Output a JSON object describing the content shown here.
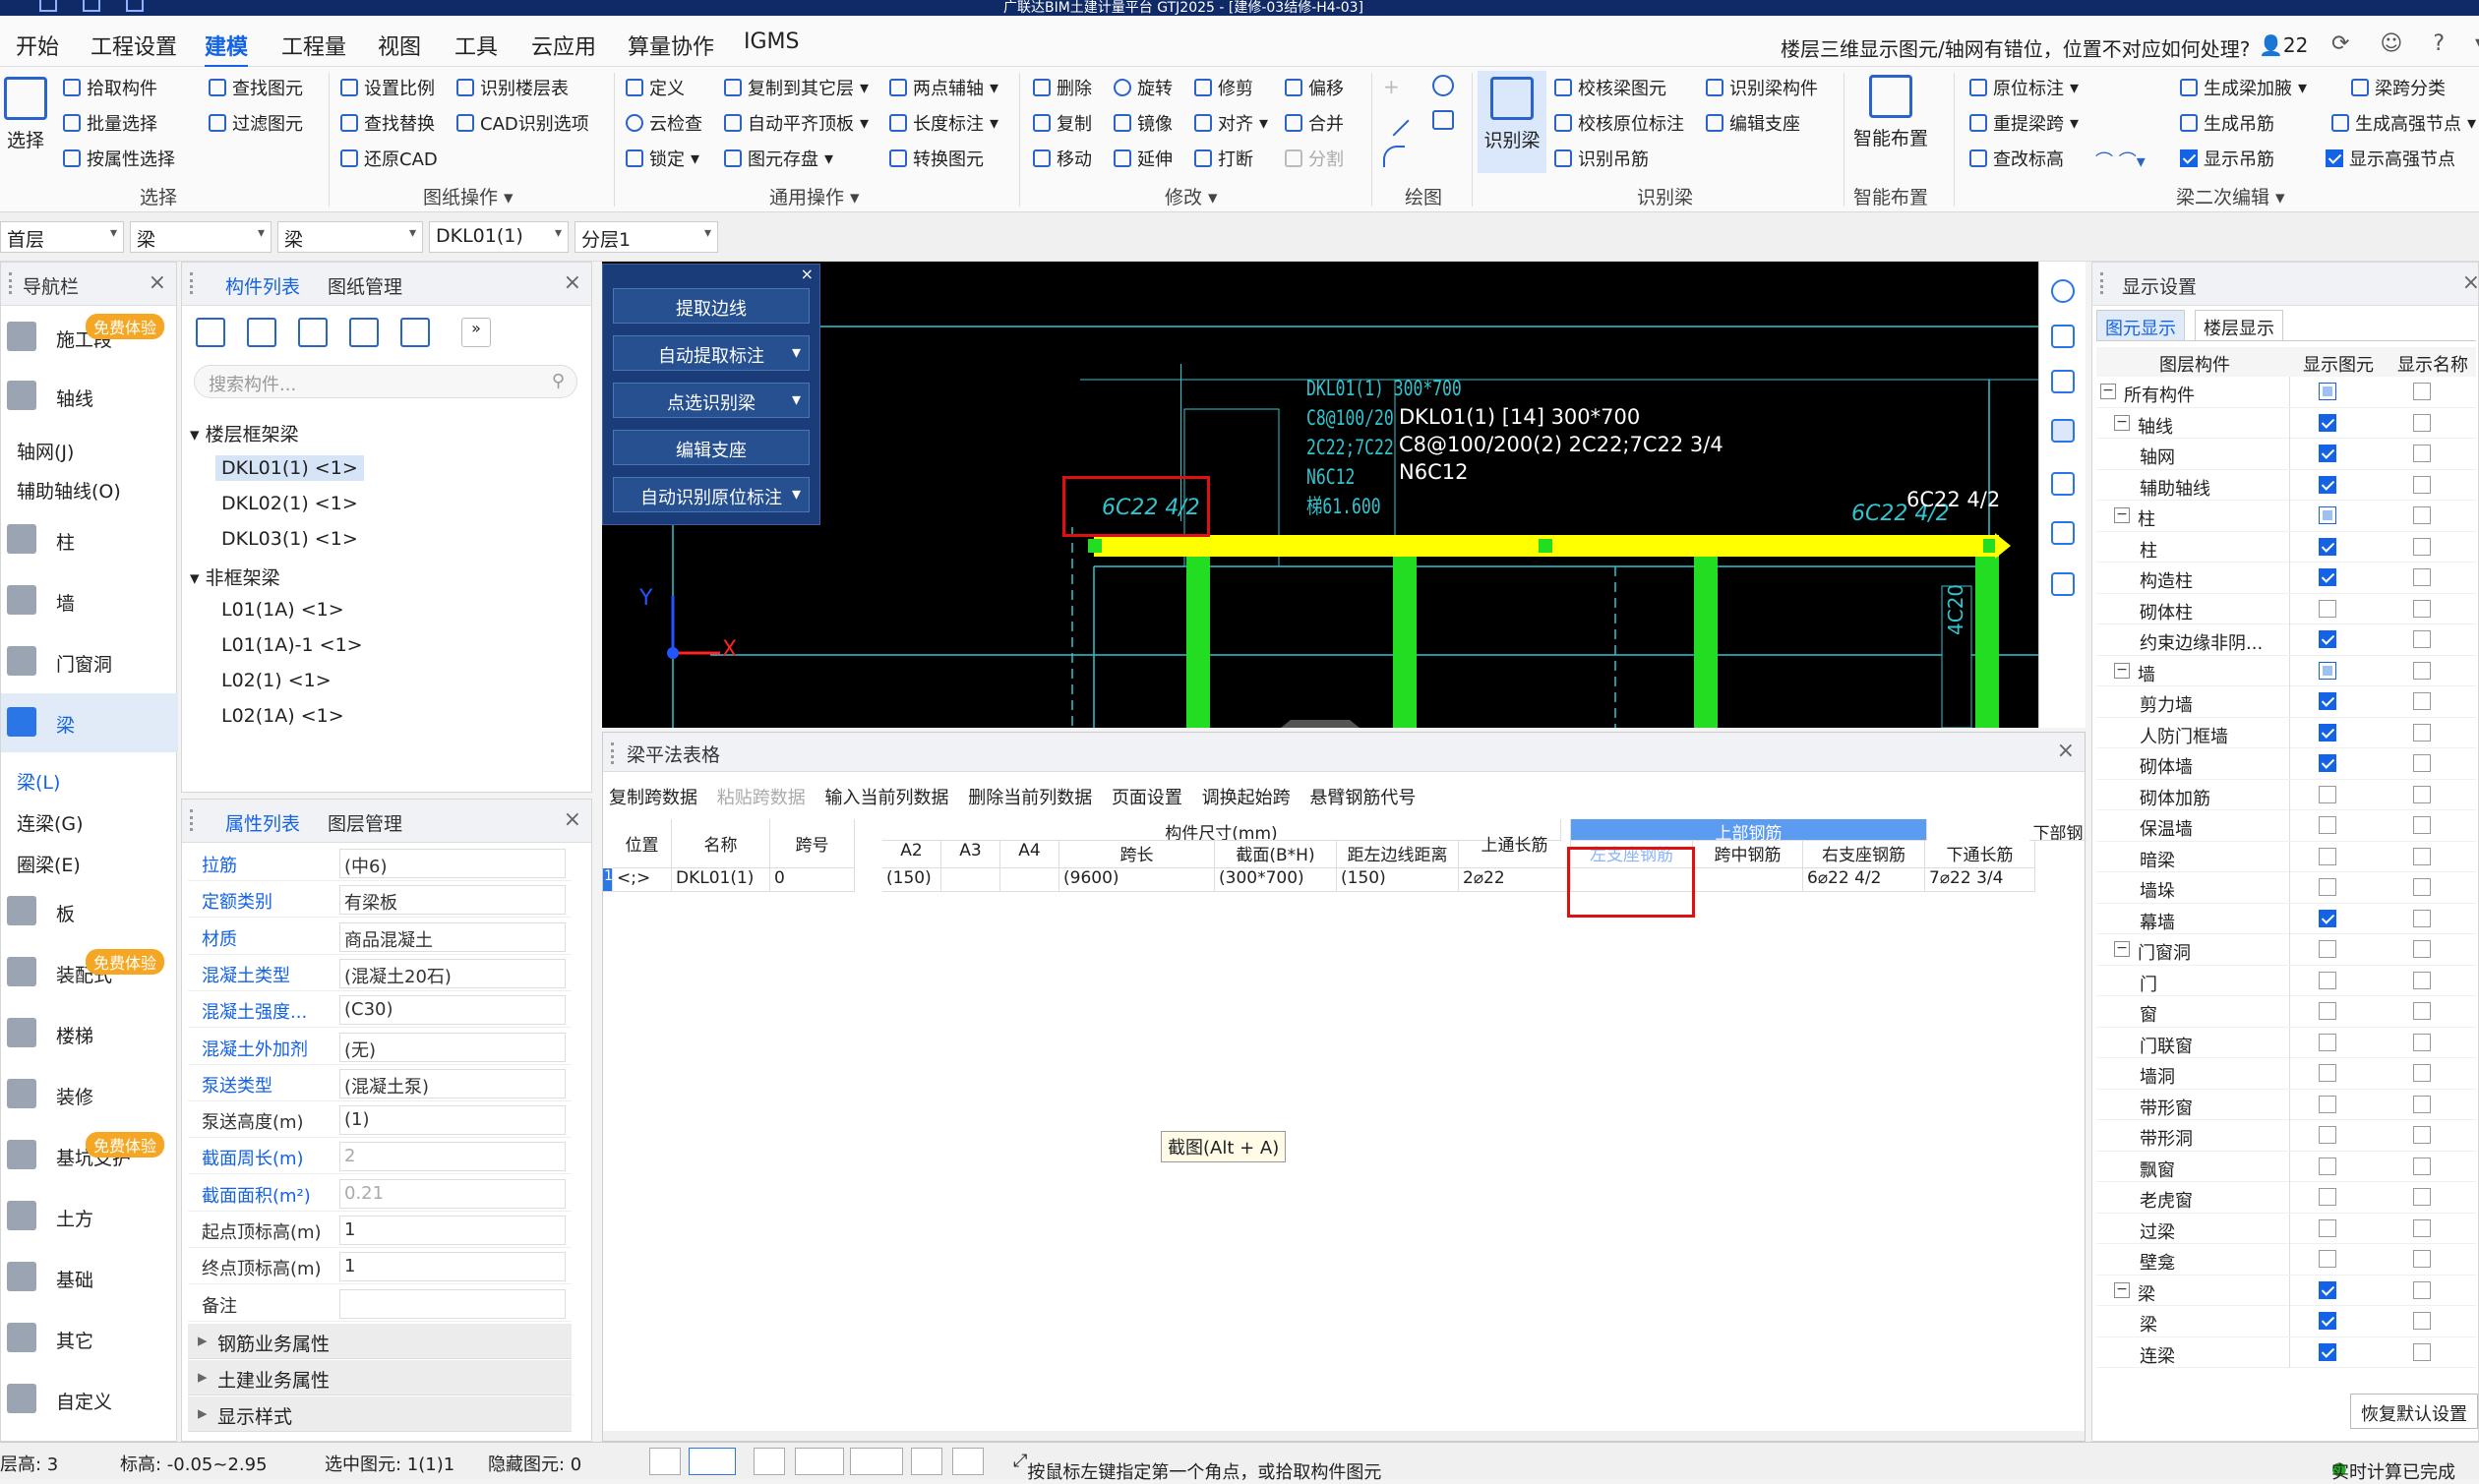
{
  "title_bar": {
    "title": "广联达BIM土建计量平台 GTJ2025 - [建修-03结修-H4-03]"
  },
  "menubar": {
    "items": [
      "开始",
      "工程设置",
      "建模",
      "工程量",
      "视图",
      "工具",
      "云应用",
      "算量协作",
      "IGMS"
    ],
    "active_index": 2,
    "search_text": "楼层三维显示图元/轴网有错位，位置不对应如何处理?",
    "user_count": "22"
  },
  "ribbon": {
    "select": {
      "big": "选择",
      "items": [
        "拾取构件",
        "批量选择",
        "按属性选择",
        "查找图元",
        "过滤图元"
      ],
      "label": "选择"
    },
    "drawing": {
      "items": [
        "设置比例",
        "识别楼层表",
        "查找替换",
        "CAD识别选项",
        "还原CAD"
      ],
      "label": "图纸操作"
    },
    "common": {
      "items": [
        "定义",
        "复制到其它层",
        "两点辅轴",
        "云检查",
        "自动平齐顶板",
        "长度标注",
        "锁定",
        "图元存盘",
        "转换图元"
      ],
      "label": "通用操作"
    },
    "modify": {
      "items": [
        "删除",
        "旋转",
        "修剪",
        "偏移",
        "复制",
        "镜像",
        "对齐",
        "合并",
        "移动",
        "延伸",
        "打断",
        "分割"
      ],
      "label": "修改"
    },
    "draw": {
      "label": "绘图"
    },
    "recognize": {
      "big": "识别梁",
      "items": [
        "校核梁图元",
        "识别梁构件",
        "校核原位标注",
        "编辑支座",
        "识别吊筋"
      ],
      "label": "识别梁"
    },
    "smart": {
      "big": "智能布置",
      "label": "智能布置"
    },
    "secondary": {
      "items": [
        "原位标注",
        "生成梁加腋",
        "梁跨分类",
        "重提梁跨",
        "生成吊筋",
        "生成高强节点",
        "查改标高",
        "显示吊筋",
        "显示高强节点"
      ],
      "label": "梁二次编辑"
    }
  },
  "filterbar": {
    "floor": "首层",
    "category": "梁",
    "type": "梁",
    "component": "DKL01(1)",
    "layer": "分层1"
  },
  "navigator": {
    "title": "导航栏",
    "items": [
      {
        "label": "施工段",
        "icon": "construction-icon",
        "badge": "免费体验"
      },
      {
        "label": "轴线",
        "icon": "axis-icon"
      },
      {
        "label": "柱",
        "icon": "column-icon"
      },
      {
        "label": "墙",
        "icon": "wall-icon"
      },
      {
        "label": "门窗洞",
        "icon": "door-icon"
      },
      {
        "label": "梁",
        "icon": "beam-icon"
      },
      {
        "label": "板",
        "icon": "slab-icon"
      },
      {
        "label": "装配式",
        "icon": "prefab-icon",
        "badge": "免费体验"
      },
      {
        "label": "楼梯",
        "icon": "stair-icon"
      },
      {
        "label": "装修",
        "icon": "decor-icon"
      },
      {
        "label": "基坑支护",
        "icon": "pit-icon",
        "badge": "免费体验"
      },
      {
        "label": "土方",
        "icon": "earth-icon"
      },
      {
        "label": "基础",
        "icon": "foundation-icon"
      },
      {
        "label": "其它",
        "icon": "other-icon"
      },
      {
        "label": "自定义",
        "icon": "custom-icon"
      }
    ],
    "axis_sub": [
      "轴网(J)",
      "辅助轴线(O)"
    ],
    "beam_sub": [
      "梁(L)",
      "连梁(G)",
      "圈梁(E)"
    ]
  },
  "component_list": {
    "tabs": [
      "构件列表",
      "图纸管理"
    ],
    "search_placeholder": "搜索构件...",
    "groups": [
      {
        "name": "楼层框架梁",
        "items": [
          "DKL01(1) <1>",
          "DKL02(1) <1>",
          "DKL03(1) <1>"
        ]
      },
      {
        "name": "非框架梁",
        "items": [
          "L01(1A) <1>",
          "L01(1A)-1 <1>",
          "L02(1) <1>",
          "L02(1A) <1>"
        ]
      }
    ]
  },
  "properties": {
    "tabs": [
      "属性列表",
      "图层管理"
    ],
    "rows": [
      {
        "name": "拉筋",
        "value": "(中6)"
      },
      {
        "name": "定额类别",
        "value": "有梁板"
      },
      {
        "name": "材质",
        "value": "商品混凝土"
      },
      {
        "name": "混凝土类型",
        "value": "(混凝土20石)"
      },
      {
        "name": "混凝土强度...",
        "value": "(C30)"
      },
      {
        "name": "混凝土外加剂",
        "value": "(无)"
      },
      {
        "name": "泵送类型",
        "value": "(混凝土泵)"
      },
      {
        "name": "泵送高度(m)",
        "value": "(1)"
      },
      {
        "name": "截面周长(m)",
        "value": "2"
      },
      {
        "name": "截面面积(m²)",
        "value": "0.21"
      },
      {
        "name": "起点顶标高(m)",
        "value": "1"
      },
      {
        "name": "终点顶标高(m)",
        "value": "1"
      },
      {
        "name": "备注",
        "value": ""
      }
    ],
    "groups": [
      "钢筋业务属性",
      "土建业务属性",
      "显示样式"
    ]
  },
  "float_panel": {
    "buttons": [
      "提取边线",
      "自动提取标注",
      "点选识别梁",
      "编辑支座",
      "自动识别原位标注"
    ]
  },
  "canvas": {
    "cad_lines": [
      "DKL01(1) 300*700",
      "C8@100/20",
      "2C22;7C22",
      "N6C12",
      "梯61.600"
    ],
    "annotation": [
      "DKL01(1) [14] 300*700",
      "C8@100/200(2) 2C22;7C22 3/4",
      "N6C12"
    ],
    "left_tag": "6C22 4/2",
    "right_tag": "6C22 4/2",
    "right_tag_cad": "6C22 4/2",
    "vert_tag": "4C20",
    "axis_x": "X",
    "axis_y": "Y"
  },
  "beam_table": {
    "title": "梁平法表格",
    "tools": [
      "复制跨数据",
      "粘贴跨数据",
      "输入当前列数据",
      "删除当前列数据",
      "页面设置",
      "调换起始跨",
      "悬臂钢筋代号"
    ],
    "group_headers": [
      "构件尺寸(mm)",
      "上部钢筋",
      "下部钢"
    ],
    "headers": [
      "位置",
      "名称",
      "跨号",
      "A2",
      "A3",
      "A4",
      "跨长",
      "截面(B*H)",
      "距左边线距离",
      "上通长筋",
      "左支座钢筋",
      "跨中钢筋",
      "右支座钢筋",
      "下通长筋"
    ],
    "row": {
      "index": "1",
      "cells": [
        "<;>",
        "DKL01(1)",
        "0",
        "(150)",
        "",
        "",
        "(9600)",
        "(300*700)",
        "(150)",
        "2⌀22",
        "",
        "",
        "6⌀22 4/2",
        "7⌀22 3/4"
      ]
    }
  },
  "tooltip": "截图(Alt + A)",
  "display_settings": {
    "title": "显示设置",
    "tabs": [
      "图元显示",
      "楼层显示"
    ],
    "cols": [
      "图层构件",
      "显示图元",
      "显示名称"
    ],
    "rows": [
      {
        "n": "所有构件",
        "lvl": 0,
        "t": "−",
        "a": "part",
        "b": ""
      },
      {
        "n": "轴线",
        "lvl": 1,
        "t": "−",
        "a": "on",
        "b": ""
      },
      {
        "n": "轴网",
        "lvl": 2,
        "a": "on",
        "b": ""
      },
      {
        "n": "辅助轴线",
        "lvl": 2,
        "a": "on",
        "b": ""
      },
      {
        "n": "柱",
        "lvl": 1,
        "t": "−",
        "a": "part",
        "b": ""
      },
      {
        "n": "柱",
        "lvl": 2,
        "a": "on",
        "b": ""
      },
      {
        "n": "构造柱",
        "lvl": 2,
        "a": "on",
        "b": ""
      },
      {
        "n": "砌体柱",
        "lvl": 2,
        "a": "",
        "b": ""
      },
      {
        "n": "约束边缘非阴...",
        "lvl": 2,
        "a": "on",
        "b": ""
      },
      {
        "n": "墙",
        "lvl": 1,
        "t": "−",
        "a": "part",
        "b": ""
      },
      {
        "n": "剪力墙",
        "lvl": 2,
        "a": "on",
        "b": ""
      },
      {
        "n": "人防门框墙",
        "lvl": 2,
        "a": "on",
        "b": ""
      },
      {
        "n": "砌体墙",
        "lvl": 2,
        "a": "on",
        "b": ""
      },
      {
        "n": "砌体加筋",
        "lvl": 2,
        "a": "",
        "b": ""
      },
      {
        "n": "保温墙",
        "lvl": 2,
        "a": "",
        "b": ""
      },
      {
        "n": "暗梁",
        "lvl": 2,
        "a": "",
        "b": ""
      },
      {
        "n": "墙垛",
        "lvl": 2,
        "a": "",
        "b": ""
      },
      {
        "n": "幕墙",
        "lvl": 2,
        "a": "on",
        "b": ""
      },
      {
        "n": "门窗洞",
        "lvl": 1,
        "t": "−",
        "a": "",
        "b": ""
      },
      {
        "n": "门",
        "lvl": 2,
        "a": "",
        "b": ""
      },
      {
        "n": "窗",
        "lvl": 2,
        "a": "",
        "b": ""
      },
      {
        "n": "门联窗",
        "lvl": 2,
        "a": "",
        "b": ""
      },
      {
        "n": "墙洞",
        "lvl": 2,
        "a": "",
        "b": ""
      },
      {
        "n": "带形窗",
        "lvl": 2,
        "a": "",
        "b": ""
      },
      {
        "n": "带形洞",
        "lvl": 2,
        "a": "",
        "b": ""
      },
      {
        "n": "飘窗",
        "lvl": 2,
        "a": "",
        "b": ""
      },
      {
        "n": "老虎窗",
        "lvl": 2,
        "a": "",
        "b": ""
      },
      {
        "n": "过梁",
        "lvl": 2,
        "a": "",
        "b": ""
      },
      {
        "n": "壁龛",
        "lvl": 2,
        "a": "",
        "b": ""
      },
      {
        "n": "梁",
        "lvl": 1,
        "t": "−",
        "a": "on",
        "b": ""
      },
      {
        "n": "梁",
        "lvl": 2,
        "a": "on",
        "b": ""
      },
      {
        "n": "连梁",
        "lvl": 2,
        "a": "on",
        "b": ""
      }
    ],
    "restore": "恢复默认设置"
  },
  "statusbar": {
    "layer": "层高: 3",
    "elev": "标高: -0.05~2.95",
    "selected": "选中图元: 1(1)1",
    "hidden": "隐藏图元: 0",
    "hint": "按鼠标左键指定第一个角点，或拾取构件图元",
    "calc": "实时计算已完成"
  },
  "colors": {
    "accent": "#1463e6",
    "beam_yellow": "#ffff00",
    "column_green": "#22dd22",
    "cad_cyan": "#2fc5cf",
    "red_box": "#e01010"
  }
}
